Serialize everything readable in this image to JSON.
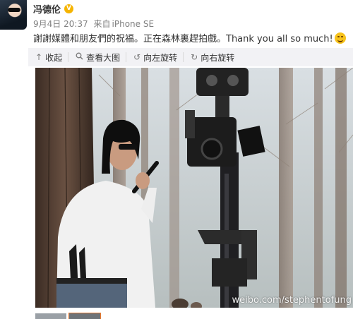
{
  "post": {
    "username": "冯德伦",
    "verified_icon": "vip-crown-icon",
    "date": "9月4日 20:37",
    "source_prefix": "来自",
    "source": "iPhone SE",
    "text": "謝謝媒體和朋友們的祝福。正在森林裏趕拍戲。Thank you all so much!",
    "emoji": "smile-emoji"
  },
  "toolbar": {
    "collapse": "收起",
    "view_large": "查看大图",
    "rotate_left": "向左旋转",
    "rotate_right": "向右旋转"
  },
  "photo": {
    "watermark": "weibo.com/stephentofung"
  },
  "colors": {
    "badge": "#f5b400",
    "toolbar_bg": "#f2f2f5"
  }
}
